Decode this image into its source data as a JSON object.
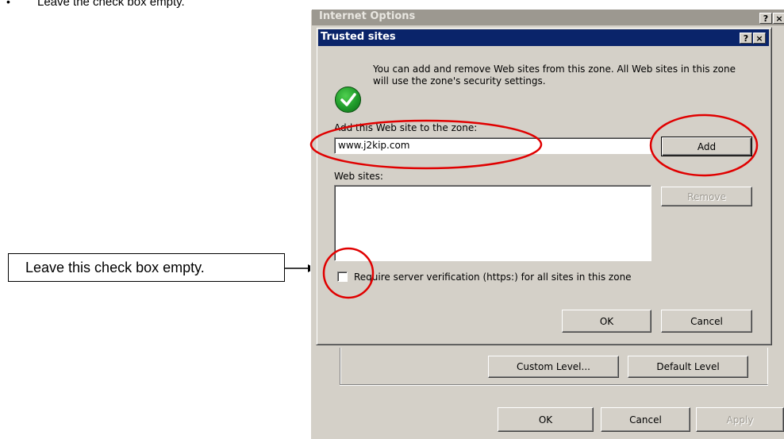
{
  "instruction": {
    "bullet_glyph": "•",
    "text": "Leave the check box empty."
  },
  "callout": {
    "text": "Leave this check box empty."
  },
  "internet_options": {
    "title": "Internet Options",
    "help_glyph": "?",
    "close_glyph": "×",
    "custom_level_label": "Custom Level...",
    "default_level_label": "Default Level",
    "ok_label": "OK",
    "cancel_label": "Cancel",
    "apply_label": "Apply"
  },
  "trusted_sites": {
    "title": "Trusted sites",
    "help_glyph": "?",
    "close_glyph": "×",
    "description": "You can add and remove Web sites from this zone. All Web sites in this zone will use the zone's security settings.",
    "add_label": "Add this Web site to the zone:",
    "site_input_value": "www.j2kip.com",
    "add_button": "Add",
    "web_sites_label": "Web sites:",
    "web_sites": [],
    "remove_button": "Remove",
    "checkbox_label": "Require server verification (https:) for all sites in this zone",
    "checkbox_checked": false,
    "ok_label": "OK",
    "cancel_label": "Cancel",
    "icon": "green-check-icon"
  },
  "colors": {
    "annotation_red": "#e00000",
    "title_active": "#0a246a",
    "title_inactive": "#9c9890",
    "dialog_face": "#d4d0c8"
  }
}
